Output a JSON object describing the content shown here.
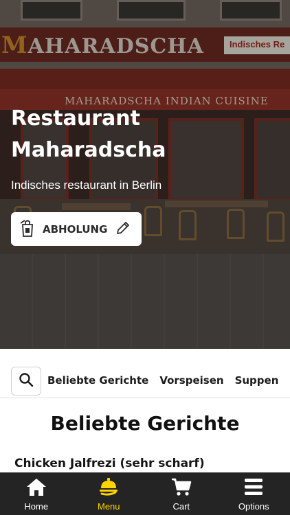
{
  "hero": {
    "sign_name": "AHARADSCHA",
    "sign_initial": "M",
    "sign_right": "Indisches Re",
    "cuisine_banner": "MAHARADSCHA INDIAN CUISINE",
    "title": "Restaurant Maharadscha",
    "subtitle": "Indisches restaurant in Berlin",
    "order_mode": {
      "label": "ABHOLUNG",
      "icon": "takeaway-bag-icon",
      "edit_icon": "pencil-icon"
    }
  },
  "categories": {
    "search_icon": "search-icon",
    "items": [
      "Beliebte Gerichte",
      "Vorspeisen",
      "Suppen"
    ]
  },
  "menu": {
    "section_title": "Beliebte Gerichte",
    "first_dish": "Chicken Jalfrezi (sehr scharf)"
  },
  "bottom_nav": {
    "items": [
      {
        "label": "Home",
        "icon": "home-icon"
      },
      {
        "label": "Menu",
        "icon": "menu-dish-icon",
        "active": true
      },
      {
        "label": "Cart",
        "icon": "cart-icon"
      },
      {
        "label": "Options",
        "icon": "hamburger-icon"
      }
    ],
    "active_color": "#ffd400",
    "background": "#242424"
  }
}
